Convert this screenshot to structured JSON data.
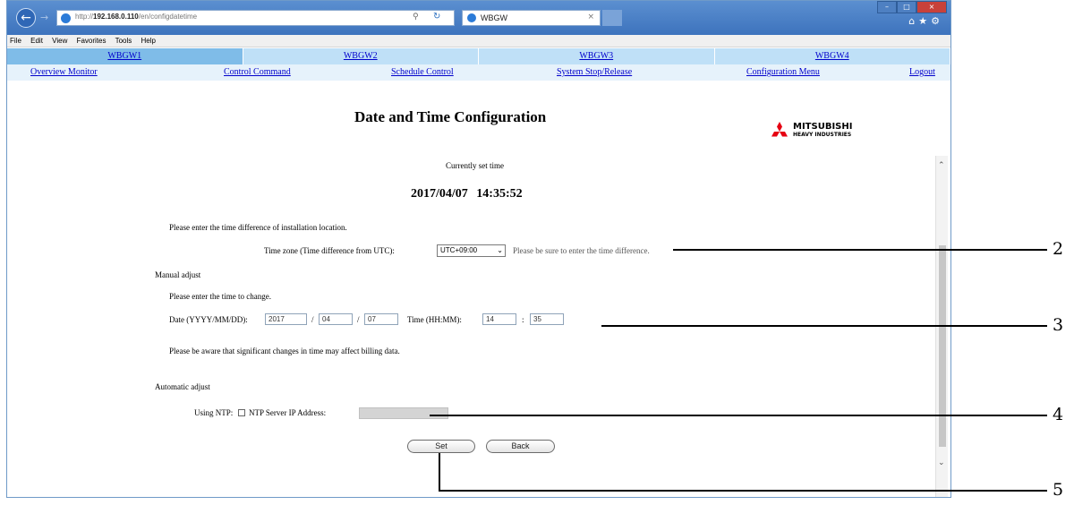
{
  "browser": {
    "url_prefix": "http://",
    "url_host": "192.168.0.110",
    "url_path": "/en/configdatetime",
    "tab_title": "WBGW"
  },
  "menu": [
    "File",
    "Edit",
    "View",
    "Favorites",
    "Tools",
    "Help"
  ],
  "unit_tabs": [
    "WBGW1",
    "WBGW2",
    "WBGW3",
    "WBGW4"
  ],
  "nav": {
    "overview": "Overview Monitor",
    "control": "Control Command",
    "schedule": "Schedule Control",
    "system": "System Stop/Release",
    "config": "Configuration Menu",
    "logout": "Logout"
  },
  "page": {
    "title": "Date and Time Configuration",
    "brand_name": "MITSUBISHI",
    "brand_sub": "HEAVY INDUSTRIES"
  },
  "current": {
    "label": "Currently set time",
    "value": "2017/04/07 14:35:52"
  },
  "timezone": {
    "instruction": "Please enter the time difference of installation location.",
    "label": "Time zone (Time difference from UTC):",
    "value": "UTC+09:00",
    "note": "Please be sure to enter the time difference."
  },
  "manual": {
    "heading": "Manual adjust",
    "instruction": "Please enter the time to change.",
    "date_label": "Date (YYYY/MM/DD):",
    "year": "2017",
    "month": "04",
    "day": "07",
    "sep": "/",
    "time_label": "Time (HH:MM):",
    "hour": "14",
    "minute": "35",
    "time_sep": ":",
    "warning": "Please be aware that significant changes in time may affect billing data."
  },
  "auto": {
    "heading": "Automatic adjust",
    "ntp_label": "Using NTP:",
    "ntp_server_label": "NTP Server IP Address:"
  },
  "buttons": {
    "set": "Set",
    "back": "Back"
  },
  "callouts": [
    "2",
    "3",
    "4",
    "5"
  ]
}
